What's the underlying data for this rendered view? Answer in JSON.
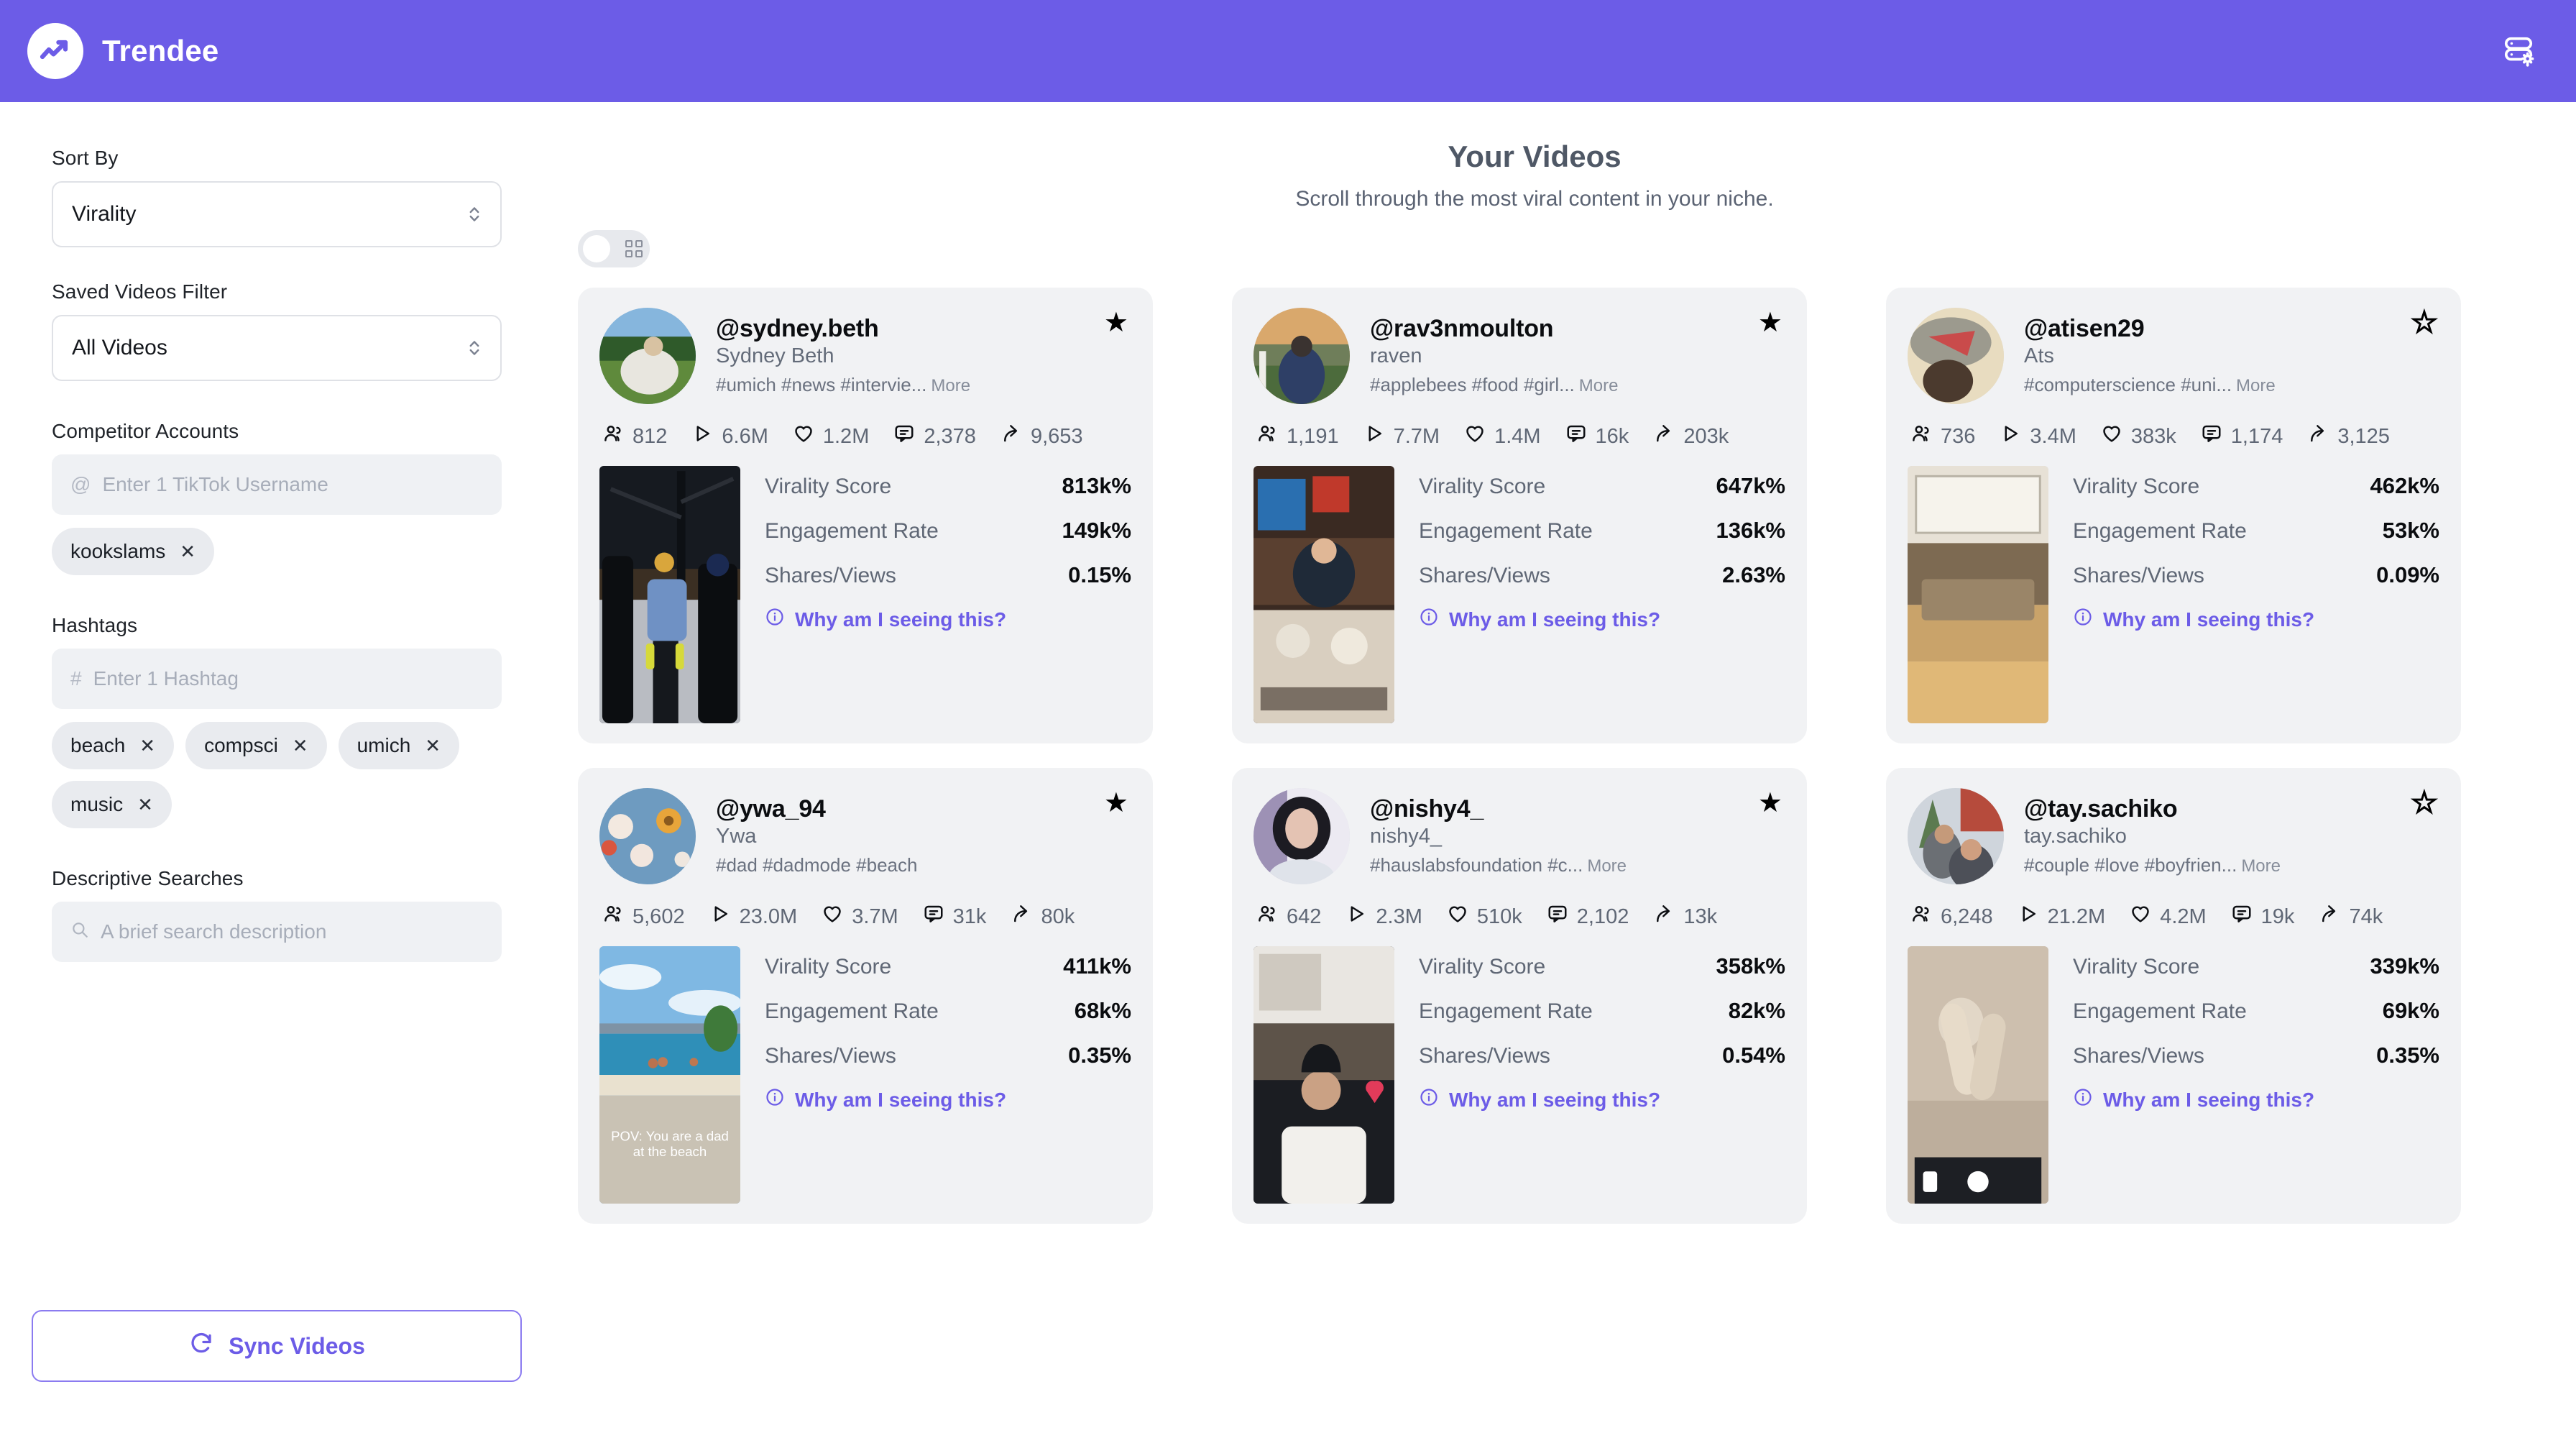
{
  "app": {
    "brand_name": "Trendee",
    "logo_icon": "trend-chart-icon",
    "settings_icon": "database-settings-icon"
  },
  "sidebar": {
    "sort_by": {
      "label": "Sort By",
      "value": "Virality",
      "chevron_icon": "chevron-up-down-icon"
    },
    "saved_filter": {
      "label": "Saved Videos Filter",
      "value": "All Videos",
      "chevron_icon": "chevron-up-down-icon"
    },
    "competitor_accounts": {
      "label": "Competitor Accounts",
      "prefix": "@",
      "placeholder": "Enter 1 TikTok Username",
      "value": "",
      "chips": [
        "kookslams"
      ]
    },
    "hashtags": {
      "label": "Hashtags",
      "prefix": "#",
      "placeholder": "Enter 1 Hashtag",
      "value": "",
      "chips": [
        "beach",
        "compsci",
        "umich",
        "music"
      ]
    },
    "descriptive_searches": {
      "label": "Descriptive Searches",
      "search_icon": "search-icon",
      "placeholder": "A brief search description",
      "value": ""
    },
    "sync_button": {
      "label": "Sync Videos",
      "icon": "refresh-icon"
    },
    "chip_remove_icon": "close-icon"
  },
  "main": {
    "title": "Your Videos",
    "subtitle": "Scroll through the most viral content in your niche.",
    "view_toggle": {
      "state": "off",
      "icon": "grid-icon"
    },
    "stat_icons": [
      "followers-icon",
      "play-icon",
      "heart-icon",
      "comment-icon",
      "share-icon"
    ],
    "metric_labels": [
      "Virality Score",
      "Engagement Rate",
      "Shares/Views"
    ],
    "why_label": "Why am I seeing this?",
    "why_icon": "info-icon",
    "more_label": "More",
    "star_icon": "star-icon",
    "cards": [
      {
        "handle": "@sydney.beth",
        "nickname": "Sydney Beth",
        "tagline": "#umich #news #intervie...",
        "has_more": true,
        "saved": true,
        "stats": [
          "812",
          "6.6M",
          "1.2M",
          "2,378",
          "9,653"
        ],
        "metrics": [
          "813k%",
          "149k%",
          "0.15%"
        ],
        "avatar_scene": "woman-grass",
        "thumb_scene": "snow-interview"
      },
      {
        "handle": "@rav3nmoulton",
        "nickname": "raven",
        "tagline": "#applebees #food #girl...",
        "has_more": true,
        "saved": true,
        "stats": [
          "1,191",
          "7.7M",
          "1.4M",
          "16k",
          "203k"
        ],
        "metrics": [
          "647k%",
          "136k%",
          "2.63%"
        ],
        "avatar_scene": "field-sunset",
        "thumb_scene": "restaurant"
      },
      {
        "handle": "@atisen29",
        "nickname": "Ats",
        "tagline": "#computerscience #uni...",
        "has_more": true,
        "saved": false,
        "stats": [
          "736",
          "3.4M",
          "383k",
          "1,174",
          "3,125"
        ],
        "metrics": [
          "462k%",
          "53k%",
          "0.09%"
        ],
        "avatar_scene": "shark-costume",
        "thumb_scene": "lecture-hall"
      },
      {
        "handle": "@ywa_94",
        "nickname": "Ywa",
        "tagline": "#dad #dadmode #beach",
        "has_more": false,
        "saved": true,
        "stats": [
          "5,602",
          "23.0M",
          "3.7M",
          "31k",
          "80k"
        ],
        "metrics": [
          "411k%",
          "68k%",
          "0.35%"
        ],
        "avatar_scene": "flowers",
        "thumb_scene": "beach"
      },
      {
        "handle": "@nishy4_",
        "nickname": "nishy4_",
        "tagline": "#hauslabsfoundation #c...",
        "has_more": true,
        "saved": true,
        "stats": [
          "642",
          "2.3M",
          "510k",
          "2,102",
          "13k"
        ],
        "metrics": [
          "358k%",
          "82k%",
          "0.54%"
        ],
        "avatar_scene": "portrait-dark",
        "thumb_scene": "indoor-person"
      },
      {
        "handle": "@tay.sachiko",
        "nickname": "tay.sachiko",
        "tagline": "#couple #love #boyfrien...",
        "has_more": true,
        "saved": false,
        "stats": [
          "6,248",
          "21.2M",
          "4.2M",
          "19k",
          "74k"
        ],
        "metrics": [
          "339k%",
          "69k%",
          "0.35%"
        ],
        "avatar_scene": "couple-street",
        "thumb_scene": "rocks-feet"
      }
    ]
  },
  "colors": {
    "brand": "#6c5ce7",
    "card_bg": "#f1f2f4",
    "muted_text": "#5f6775"
  }
}
